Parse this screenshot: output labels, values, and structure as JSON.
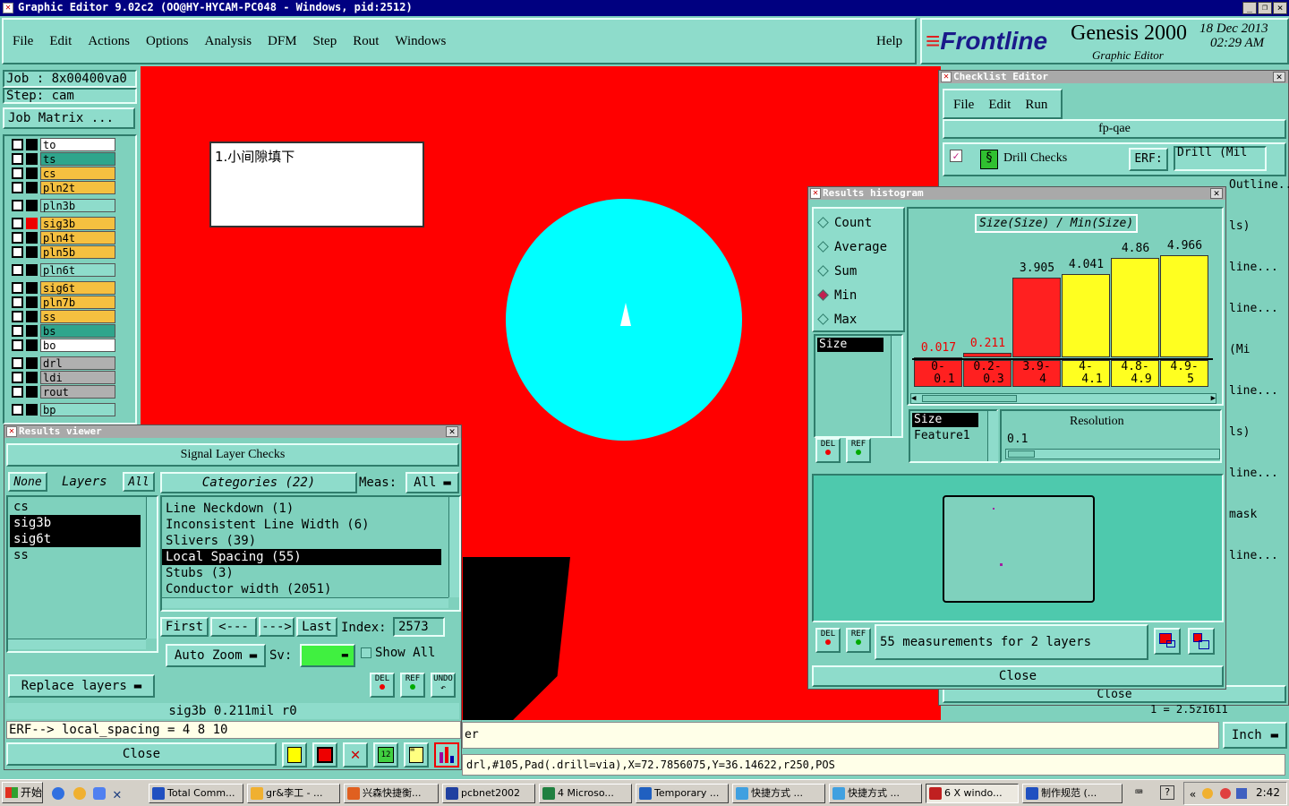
{
  "window": {
    "title": "Graphic Editor 9.02c2  (OO@HY-HYCAM-PC048 - Windows, pid:2512)"
  },
  "menu": [
    "File",
    "Edit",
    "Actions",
    "Options",
    "Analysis",
    "DFM",
    "Step",
    "Rout",
    "Windows"
  ],
  "help_label": "Help",
  "brand": {
    "logo": "Frontline",
    "product": "Genesis 2000",
    "subtitle": "Graphic Editor",
    "date": "18 Dec 2013",
    "time": "02:29 AM"
  },
  "job": {
    "job_label": "Job  : 8x00400va0",
    "step_label": "Step: cam",
    "matrix_button": "Job Matrix ..."
  },
  "layers": [
    {
      "name": "to",
      "color": "#ffffff",
      "group": 1
    },
    {
      "name": "ts",
      "color": "#2fa58c",
      "group": 1
    },
    {
      "name": "cs",
      "color": "#f5c040",
      "group": 1
    },
    {
      "name": "pln2t",
      "color": "#f5c040",
      "group": 1
    },
    {
      "name": "pln3b",
      "color": "#8edccb",
      "group": 2
    },
    {
      "name": "sig3b",
      "color": "#f5c040",
      "group": 3
    },
    {
      "name": "pln4t",
      "color": "#f5c040",
      "group": 3
    },
    {
      "name": "pln5b",
      "color": "#f5c040",
      "group": 3
    },
    {
      "name": "pln6t",
      "color": "#8edccb",
      "group": 4
    },
    {
      "name": "sig6t",
      "color": "#f5c040",
      "group": 5
    },
    {
      "name": "pln7b",
      "color": "#f5c040",
      "group": 5
    },
    {
      "name": "ss",
      "color": "#f5c040",
      "group": 5
    },
    {
      "name": "bs",
      "color": "#2fa58c",
      "group": 5
    },
    {
      "name": "bo",
      "color": "#ffffff",
      "group": 5
    },
    {
      "name": "drl",
      "color": "#b0b0b0",
      "group": 6
    },
    {
      "name": "ldi",
      "color": "#b0b0b0",
      "group": 6
    },
    {
      "name": "rout",
      "color": "#b0b0b0",
      "group": 6
    },
    {
      "name": "bp",
      "color": "#8edccb",
      "group": 7
    }
  ],
  "canvas": {
    "note_text": "1.小间隙填下"
  },
  "checklist": {
    "title": "Checklist Editor",
    "menu": [
      "File",
      "Edit",
      "Run"
    ],
    "name": "fp-qae",
    "drill_checks": "Drill Checks",
    "erf_label": "ERF:",
    "erf_value": "Drill (Mil",
    "close": "Close",
    "partials": [
      "Outline...",
      "ls)",
      "line...",
      "line...",
      "(Mi",
      "line...",
      "ls)",
      "line...",
      "mask",
      "line..."
    ],
    "coord_stub": "1 = 2.5z1611"
  },
  "results_viewer": {
    "title": "Results viewer",
    "header": "Signal Layer Checks",
    "none_btn": "None",
    "layers_label": "Layers",
    "all_btn": "All",
    "categories_label": "Categories (22)",
    "meas_label": "Meas:",
    "meas_value": "All",
    "layer_items": [
      {
        "name": "cs",
        "selected": false
      },
      {
        "name": "sig3b",
        "selected": true
      },
      {
        "name": "sig6t",
        "selected": true
      },
      {
        "name": "ss",
        "selected": false
      }
    ],
    "categories": [
      {
        "name": "Line Neckdown (1)",
        "selected": false
      },
      {
        "name": "Inconsistent Line Width (6)",
        "selected": false
      },
      {
        "name": "Slivers (39)",
        "selected": false
      },
      {
        "name": "Local Spacing (55)",
        "selected": true
      },
      {
        "name": "Stubs (3)",
        "selected": false
      },
      {
        "name": "Conductor width (2051)",
        "selected": false
      }
    ],
    "first": "First",
    "prev": "<---",
    "next": "--->",
    "last": "Last",
    "index_label": "Index:",
    "index_value": "2573",
    "auto_zoom": "Auto Zoom",
    "sv_label": "Sv:",
    "show_all": "Show All",
    "replace_layers": "Replace layers",
    "status": "sig3b 0.211mil  r0",
    "erf_line": "ERF--> local_spacing = 4 8 10",
    "close": "Close",
    "del": "DEL",
    "ref": "REF",
    "undo": "UNDO"
  },
  "histogram": {
    "title": "Results histogram",
    "modes": [
      {
        "label": "Count",
        "selected": false
      },
      {
        "label": "Average",
        "selected": false
      },
      {
        "label": "Sum",
        "selected": false
      },
      {
        "label": "Min",
        "selected": true
      },
      {
        "label": "Max",
        "selected": false
      }
    ],
    "field": "Size",
    "chart_title": "Size(Size) / Min(Size)",
    "fields2": [
      "Size",
      "Feature1"
    ],
    "resolution_label": "Resolution",
    "resolution_value": "0.1",
    "summary": "55 measurements for 2 layers",
    "close": "Close",
    "del": "DEL",
    "ref": "REF"
  },
  "chart_data": {
    "type": "bar",
    "title": "Size(Size) / Min(Size)",
    "categories": [
      "0-0.1",
      "0.2-0.3",
      "3.9-4",
      "4-4.1",
      "4.8-4.9",
      "4.9-5"
    ],
    "values": [
      0.017,
      0.211,
      3.905,
      4.041,
      4.86,
      4.966
    ],
    "value_labels": [
      "0.017",
      "0.211",
      "3.905",
      "4.041",
      "4.86",
      "4.966"
    ],
    "bin_top": [
      "0-",
      "0.2-",
      "3.9-",
      "4-",
      "4.8-",
      "4.9-"
    ],
    "bin_bottom": [
      "0.1",
      "0.3",
      "4",
      "4.1",
      "4.9",
      "5"
    ],
    "colors": [
      "#ff2020",
      "#ff2020",
      "#ff2020",
      "#ffff20",
      "#ffff20",
      "#ffff20"
    ],
    "ylim": [
      0,
      5.5
    ]
  },
  "bottom": {
    "prompt_stub": "er",
    "units": "Inch",
    "status": "drl,#105,Pad(.drill=via),X=72.7856075,Y=36.14622,r250,POS"
  },
  "taskbar": {
    "start": "开始",
    "items": [
      "Total Comm...",
      "gr&李工 - ...",
      "兴森快捷衡...",
      "pcbnet2002",
      "4 Microso...",
      "Temporary ...",
      "快捷方式 ...",
      "快捷方式 ...",
      "6 X windo...",
      "制作规范 (..."
    ],
    "clock": "2:42"
  }
}
